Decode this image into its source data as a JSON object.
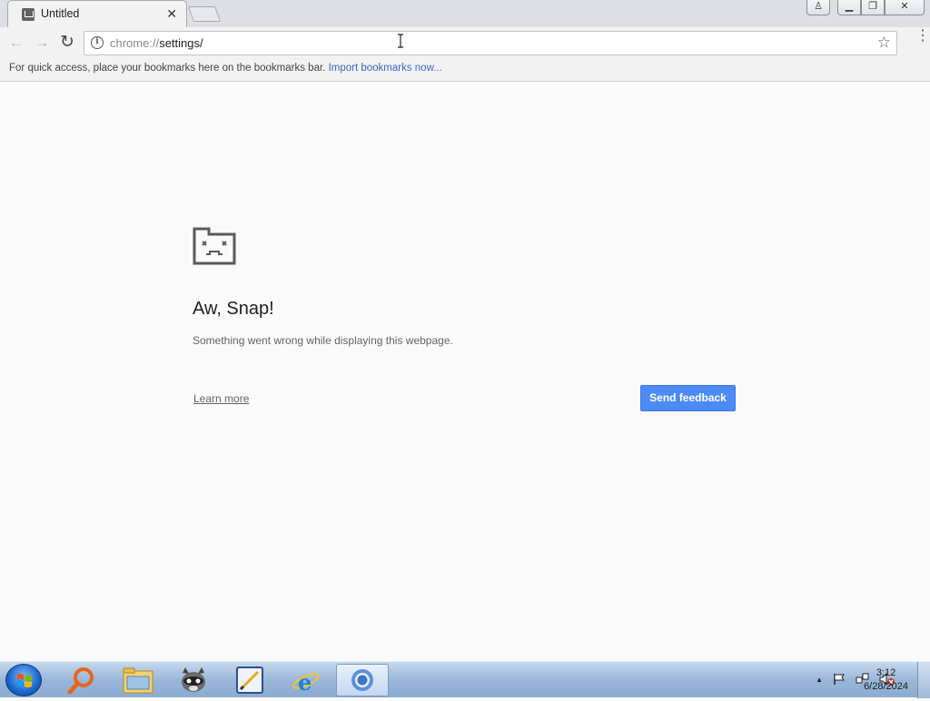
{
  "tab": {
    "title": "Untitled",
    "close_glyph": "✕"
  },
  "window_controls": {
    "user": "♙",
    "minimize": "▁",
    "restore": "❐",
    "close": "✕"
  },
  "toolbar": {
    "back_glyph": "←",
    "forward_glyph": "→",
    "reload_glyph": "↻",
    "url_scheme": "chrome://",
    "url_rest": "settings/",
    "star_glyph": "☆",
    "menu_glyph": "⋮"
  },
  "bookmarks_bar": {
    "hint": "For quick access, place your bookmarks here on the bookmarks bar.",
    "import_link": "Import bookmarks now..."
  },
  "error_page": {
    "headline": "Aw, Snap!",
    "message": "Something went wrong while displaying this webpage.",
    "learn_more": "Learn more",
    "send_feedback": "Send feedback"
  },
  "taskbar": {
    "apps": [
      {
        "name": "search-app",
        "active": false
      },
      {
        "name": "explorer",
        "active": false
      },
      {
        "name": "raccoon-app",
        "active": false
      },
      {
        "name": "drawing-app",
        "active": false
      },
      {
        "name": "internet-explorer",
        "active": false
      },
      {
        "name": "chrome",
        "active": true
      }
    ],
    "tray_arrow": "▲",
    "time": "3:12",
    "date": "6/28/2024"
  },
  "colors": {
    "accent": "#4c8bf5",
    "link": "#3b68c1",
    "page_bg": "#fafafa",
    "chrome_frame": "#f2f2f2"
  }
}
